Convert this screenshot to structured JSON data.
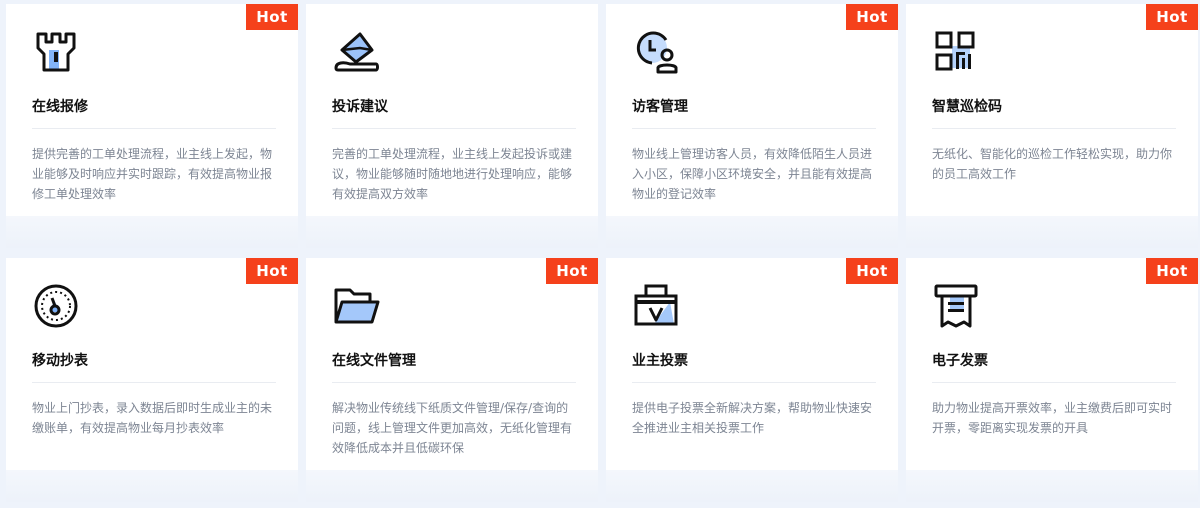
{
  "badge": "Hot",
  "colors": {
    "hot": "#f5411b",
    "accent": "#3d7ef0",
    "title": "#111111",
    "desc": "#7d8593"
  },
  "cards": [
    {
      "icon": "repair-tool-icon",
      "title": "在线报修",
      "desc": "提供完善的工单处理流程，业主线上发起，物业能够及时响应并实时跟踪，有效提高物业报修工单处理效率"
    },
    {
      "icon": "complaint-envelope-icon",
      "title": "投诉建议",
      "desc": "完善的工单处理流程，业主线上发起投诉或建议，物业能够随时随地地进行处理响应，能够有效提高双方效率"
    },
    {
      "icon": "visitor-clock-icon",
      "title": "访客管理",
      "desc": "物业线上管理访客人员，有效降低陌生人员进入小区，保障小区环境安全，并且能有效提高物业的登记效率"
    },
    {
      "icon": "qr-code-icon",
      "title": "智慧巡检码",
      "desc": "无纸化、智能化的巡检工作轻松实现，助力你的员工高效工作"
    },
    {
      "icon": "meter-gauge-icon",
      "title": "移动抄表",
      "desc": "物业上门抄表，录入数据后即时生成业主的未缴账单，有效提高物业每月抄表效率"
    },
    {
      "icon": "folder-icon",
      "title": "在线文件管理",
      "desc": "解决物业传统线下纸质文件管理/保存/查询的问题，线上管理文件更加高效，无纸化管理有效降低成本并且低碳环保"
    },
    {
      "icon": "ballot-box-icon",
      "title": "业主投票",
      "desc": "提供电子投票全新解决方案，帮助物业快速安全推进业主相关投票工作"
    },
    {
      "icon": "invoice-icon",
      "title": "电子发票",
      "desc": "助力物业提高开票效率，业主缴费后即可实时开票，零距离实现发票的开具"
    }
  ]
}
